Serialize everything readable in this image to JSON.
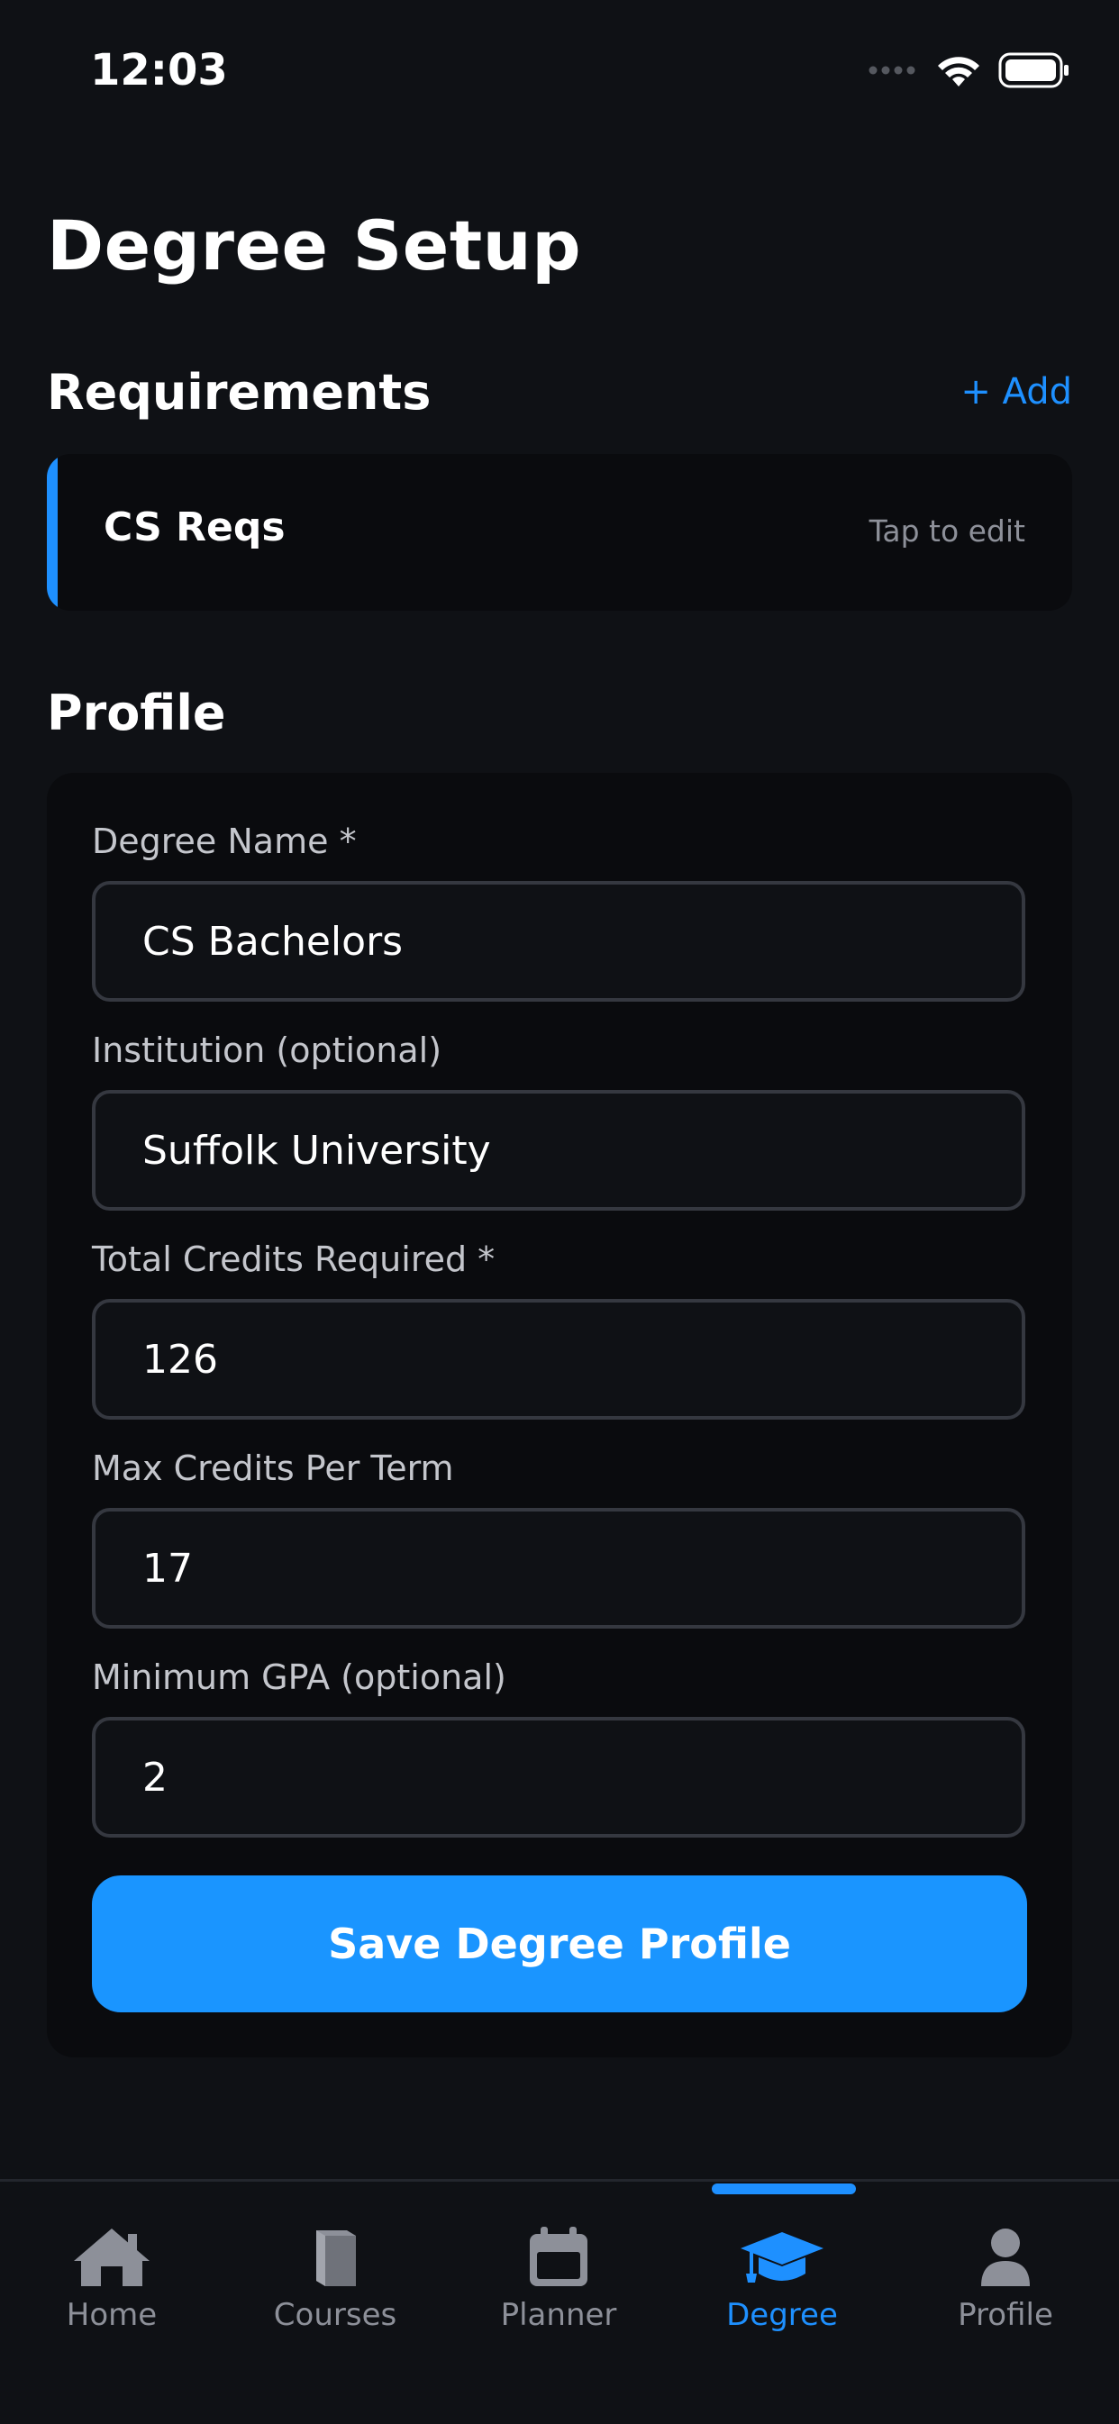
{
  "status_bar": {
    "time": "12:03",
    "icons": [
      "signal-icon",
      "wifi-icon",
      "battery-icon"
    ]
  },
  "page": {
    "title": "Degree Setup"
  },
  "requirements": {
    "title": "Requirements",
    "add_label": "+ Add",
    "items": [
      {
        "name": "CS Reqs",
        "hint": "Tap to edit"
      }
    ]
  },
  "profile": {
    "title": "Profile",
    "fields": {
      "degree_name": {
        "label": "Degree Name *",
        "value": "CS Bachelors"
      },
      "institution": {
        "label": "Institution (optional)",
        "value": "Suffolk University"
      },
      "total_credits": {
        "label": "Total Credits Required *",
        "value": "126"
      },
      "max_credits": {
        "label": "Max Credits Per Term",
        "value": "17"
      },
      "min_gpa": {
        "label": "Minimum GPA (optional)",
        "value": "2"
      }
    },
    "save_label": "Save Degree Profile"
  },
  "tab_bar": {
    "tabs": [
      {
        "label": "Home",
        "icon": "house-icon",
        "active": false
      },
      {
        "label": "Courses",
        "icon": "book-icon",
        "active": false
      },
      {
        "label": "Planner",
        "icon": "calendar-icon",
        "active": false
      },
      {
        "label": "Degree",
        "icon": "graduation-cap-icon",
        "active": true
      },
      {
        "label": "Profile",
        "icon": "person-icon",
        "active": false
      }
    ]
  },
  "colors": {
    "background": "#0f1115",
    "card": "#0a0b0e",
    "accent": "#1e90ff",
    "button": "#1a95ff",
    "muted_text": "#8d9099",
    "input_border": "#353840"
  }
}
